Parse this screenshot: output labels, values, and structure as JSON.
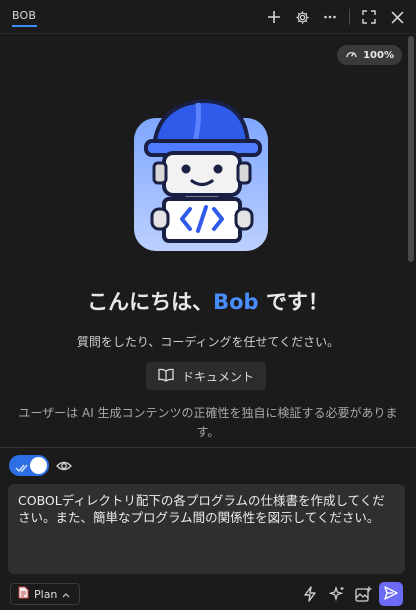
{
  "header": {
    "tab_label": "BOB",
    "icons": [
      "plus-icon",
      "gear-icon",
      "more-icon",
      "expand-icon",
      "close-icon"
    ]
  },
  "zoom": {
    "value": "100%"
  },
  "main": {
    "greeting_prefix": "こんにちは、",
    "greeting_name": "Bob",
    "greeting_suffix": " です！",
    "subtitle": "質問をしたり、コーディングを任せてください。",
    "docs_button": "ドキュメント",
    "disclaimer": "ユーザーは AI 生成コンテンツの正確性を独自に検証する必要があります。"
  },
  "composer": {
    "auto_approve_enabled": true,
    "prompt_text": "COBOLディレクトリ配下の各プログラムの仕様書を作成してください。また、簡単なプログラム間の関係性を図示してください。",
    "mode_label": "Plan"
  },
  "colors": {
    "accent": "#4a8dff",
    "send": "#6b6bf5",
    "toggle": "#2e6fe6"
  }
}
